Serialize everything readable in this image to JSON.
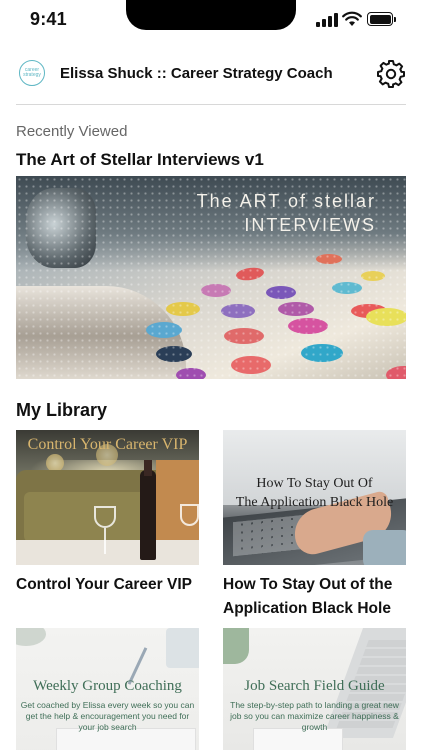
{
  "status_bar": {
    "time": "9:41"
  },
  "header": {
    "logo_text": "career strategy",
    "title": "Elissa Shuck :: Career Strategy Coach",
    "settings_icon": "gear-icon"
  },
  "recently_viewed": {
    "label": "Recently Viewed",
    "title": "The Art of Stellar Interviews v1",
    "image_text_line1": "The ART of stellar",
    "image_text_line2": "INTERVIEWS"
  },
  "library": {
    "heading": "My Library",
    "items": [
      {
        "title": "Control Your Career VIP",
        "image_text": "Control Your Career VIP"
      },
      {
        "title": "How To Stay Out of the Application Black Hole",
        "image_text_line1": "How To Stay Out Of",
        "image_text_line2": "The Application Black Hole"
      },
      {
        "title": "",
        "image_text": "Weekly Group Coaching",
        "image_subtext": "Get coached by Elissa every week so you can get the help & encouragement you need for your job search"
      },
      {
        "title": "",
        "image_text": "Job Search Field Guide",
        "image_subtext": "The step-by-step path to landing a great new job so you can maximize career happiness & growth"
      }
    ]
  },
  "colors": {
    "accent_teal": "#5fb7c4",
    "text_primary": "#111111",
    "text_secondary": "#666666",
    "divider": "#d8d8d8",
    "serif_green": "#3f6e57",
    "serif_gold": "#c8a56a"
  }
}
